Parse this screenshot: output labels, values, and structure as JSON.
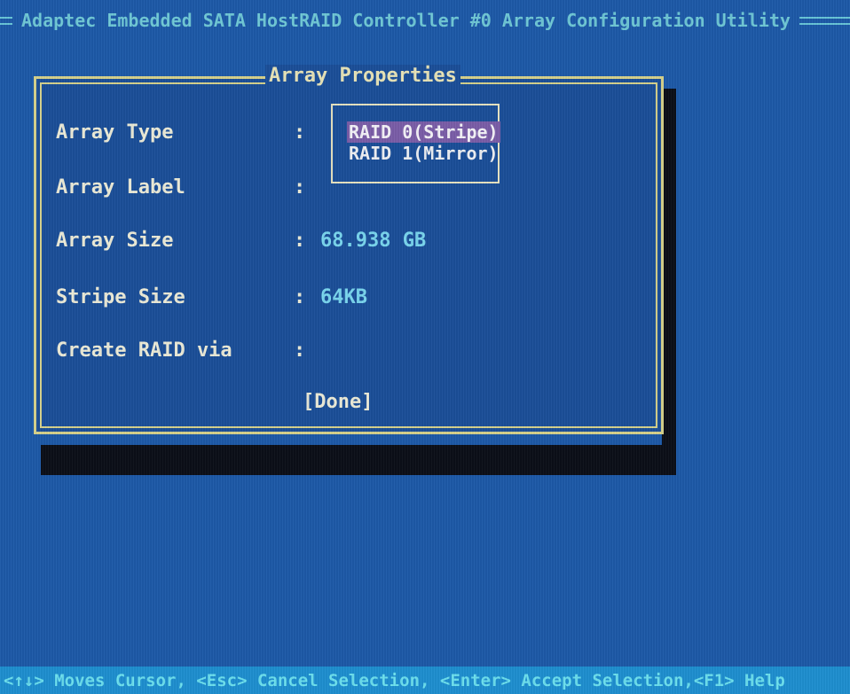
{
  "header": {
    "title": "Adaptec Embedded SATA HostRAID Controller #0 Array Configuration Utility"
  },
  "dialog": {
    "title": "Array Properties",
    "fields": [
      {
        "label": "Array Type",
        "colon": ":",
        "value": ""
      },
      {
        "label": "Array Label",
        "colon": ":",
        "value": ""
      },
      {
        "label": "Array Size",
        "colon": ":",
        "value": "68.938 GB"
      },
      {
        "label": "Stripe Size",
        "colon": ":",
        "value": "64KB"
      },
      {
        "label": "Create RAID via",
        "colon": ":",
        "value": ""
      }
    ],
    "dropdown": {
      "options": [
        "RAID 0(Stripe)",
        "RAID 1(Mirror)"
      ],
      "selected": "RAID 0(Stripe)"
    },
    "done_label": "[Done]"
  },
  "status_bar": {
    "text": "<↑↓> Moves Cursor, <Esc> Cancel Selection, <Enter> Accept Selection,<F1> Help"
  },
  "colors": {
    "background": "#1d5aa8",
    "dialog_border": "#d6d28c",
    "value_text": "#7ad6ee",
    "selection_highlight": "#7b5ea8",
    "status_bar": "#1e8fd0"
  }
}
